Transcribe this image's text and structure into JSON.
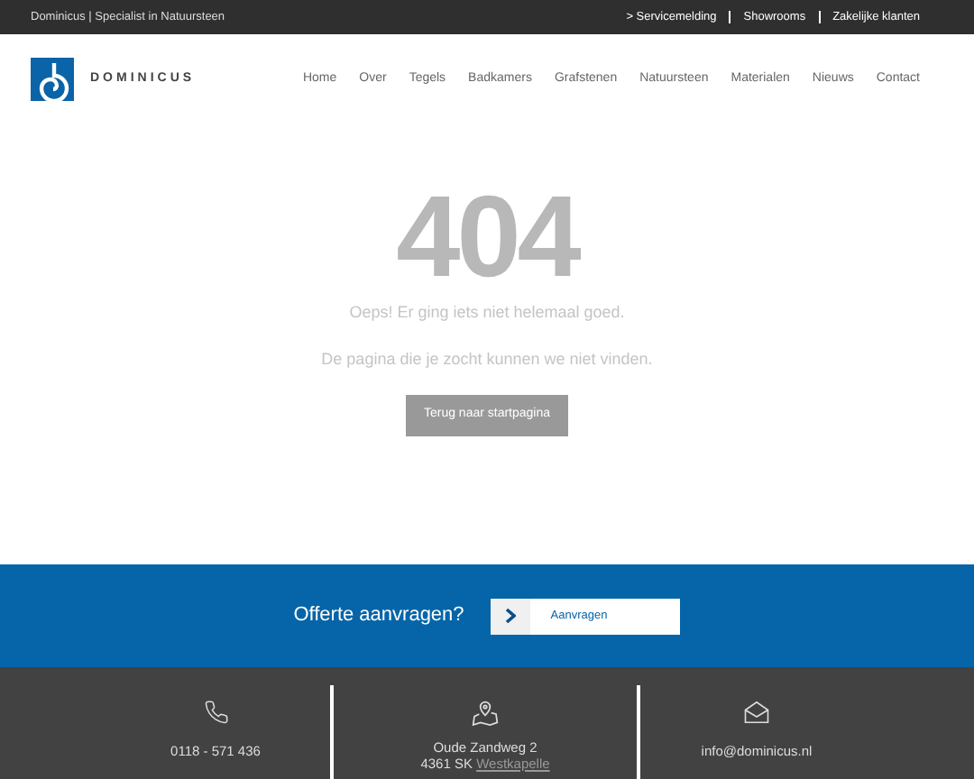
{
  "top_bar": {
    "tagline": "Dominicus | Specialist in Natuursteen",
    "links": [
      {
        "label": "> Servicemelding"
      },
      {
        "label": "Showrooms"
      },
      {
        "label": "Zakelijke klanten"
      }
    ]
  },
  "header": {
    "logo_text": "DOMINICUS",
    "nav": [
      {
        "label": "Home"
      },
      {
        "label": "Over"
      },
      {
        "label": "Tegels"
      },
      {
        "label": "Badkamers"
      },
      {
        "label": "Grafstenen"
      },
      {
        "label": "Natuursteen"
      },
      {
        "label": "Materialen"
      },
      {
        "label": "Nieuws"
      },
      {
        "label": "Contact"
      }
    ]
  },
  "error": {
    "code": "404",
    "message": "Oeps! Er ging iets niet helemaal goed.",
    "detail": "De pagina die je zocht kunnen we niet vinden.",
    "button": "Terug naar startpagina"
  },
  "quote_band": {
    "title": "Offerte aanvragen?",
    "button": "Aanvragen"
  },
  "footer": {
    "phone": "0118 - 571 436",
    "address_line": "Oude Zandweg 2",
    "postcode": "4361 SK",
    "city": "Westkapelle",
    "email": "info@dominicus.nl"
  }
}
